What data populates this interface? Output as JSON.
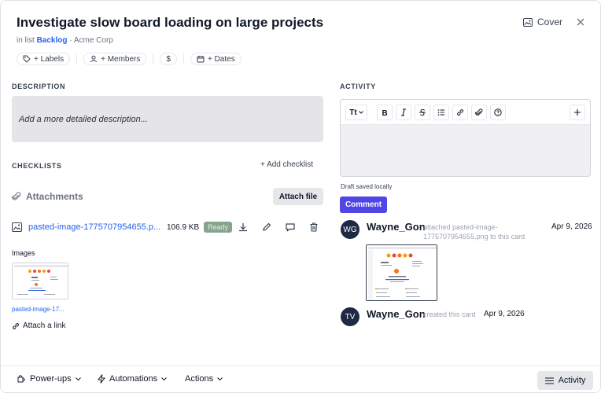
{
  "card": {
    "title": "Investigate slow board loading on large projects",
    "in_list_prefix": "in list",
    "list_name": "Backlog",
    "workspace": "· Acme Corp"
  },
  "header": {
    "cover_label": "Cover"
  },
  "chips": {
    "labels": "+ Labels",
    "members": "+ Members",
    "price": "$",
    "dates": "+ Dates"
  },
  "description": {
    "heading": "DESCRIPTION",
    "placeholder": "Add a more detailed description..."
  },
  "checklists": {
    "heading": "CHECKLISTS",
    "add_label": "+ Add checklist"
  },
  "attachments": {
    "heading": "Attachments",
    "attach_file_label": "Attach file",
    "file": {
      "name": "pasted-image-1775707954655.p...",
      "size": "106.9 KB",
      "status": "Ready"
    },
    "images_label": "Images",
    "image_caption": "pasted-image-17...",
    "attach_link_label": "Attach a link"
  },
  "activity": {
    "heading": "ACTIVITY",
    "toolbar": {
      "text_style": "Tt"
    },
    "draft_saved": "Draft saved locally",
    "comment_label": "Comment",
    "entries": [
      {
        "initials": "WG",
        "user": "Wayne_Gon",
        "text": "attached pasted-image-1775707954655.png to this card",
        "date": "Apr 9, 2026"
      },
      {
        "initials": "TV",
        "user": "Wayne_Gon",
        "text": "created this card",
        "date": "Apr 9, 2026"
      }
    ]
  },
  "footer": {
    "powerups": "Power-ups",
    "automations": "Automations",
    "actions": "Actions",
    "activity": "Activity"
  },
  "colors": {
    "accent": "#4f46e5",
    "link": "#2563eb",
    "ready_badge": "#86a38c",
    "avatar_bg": "#1e2a44"
  }
}
